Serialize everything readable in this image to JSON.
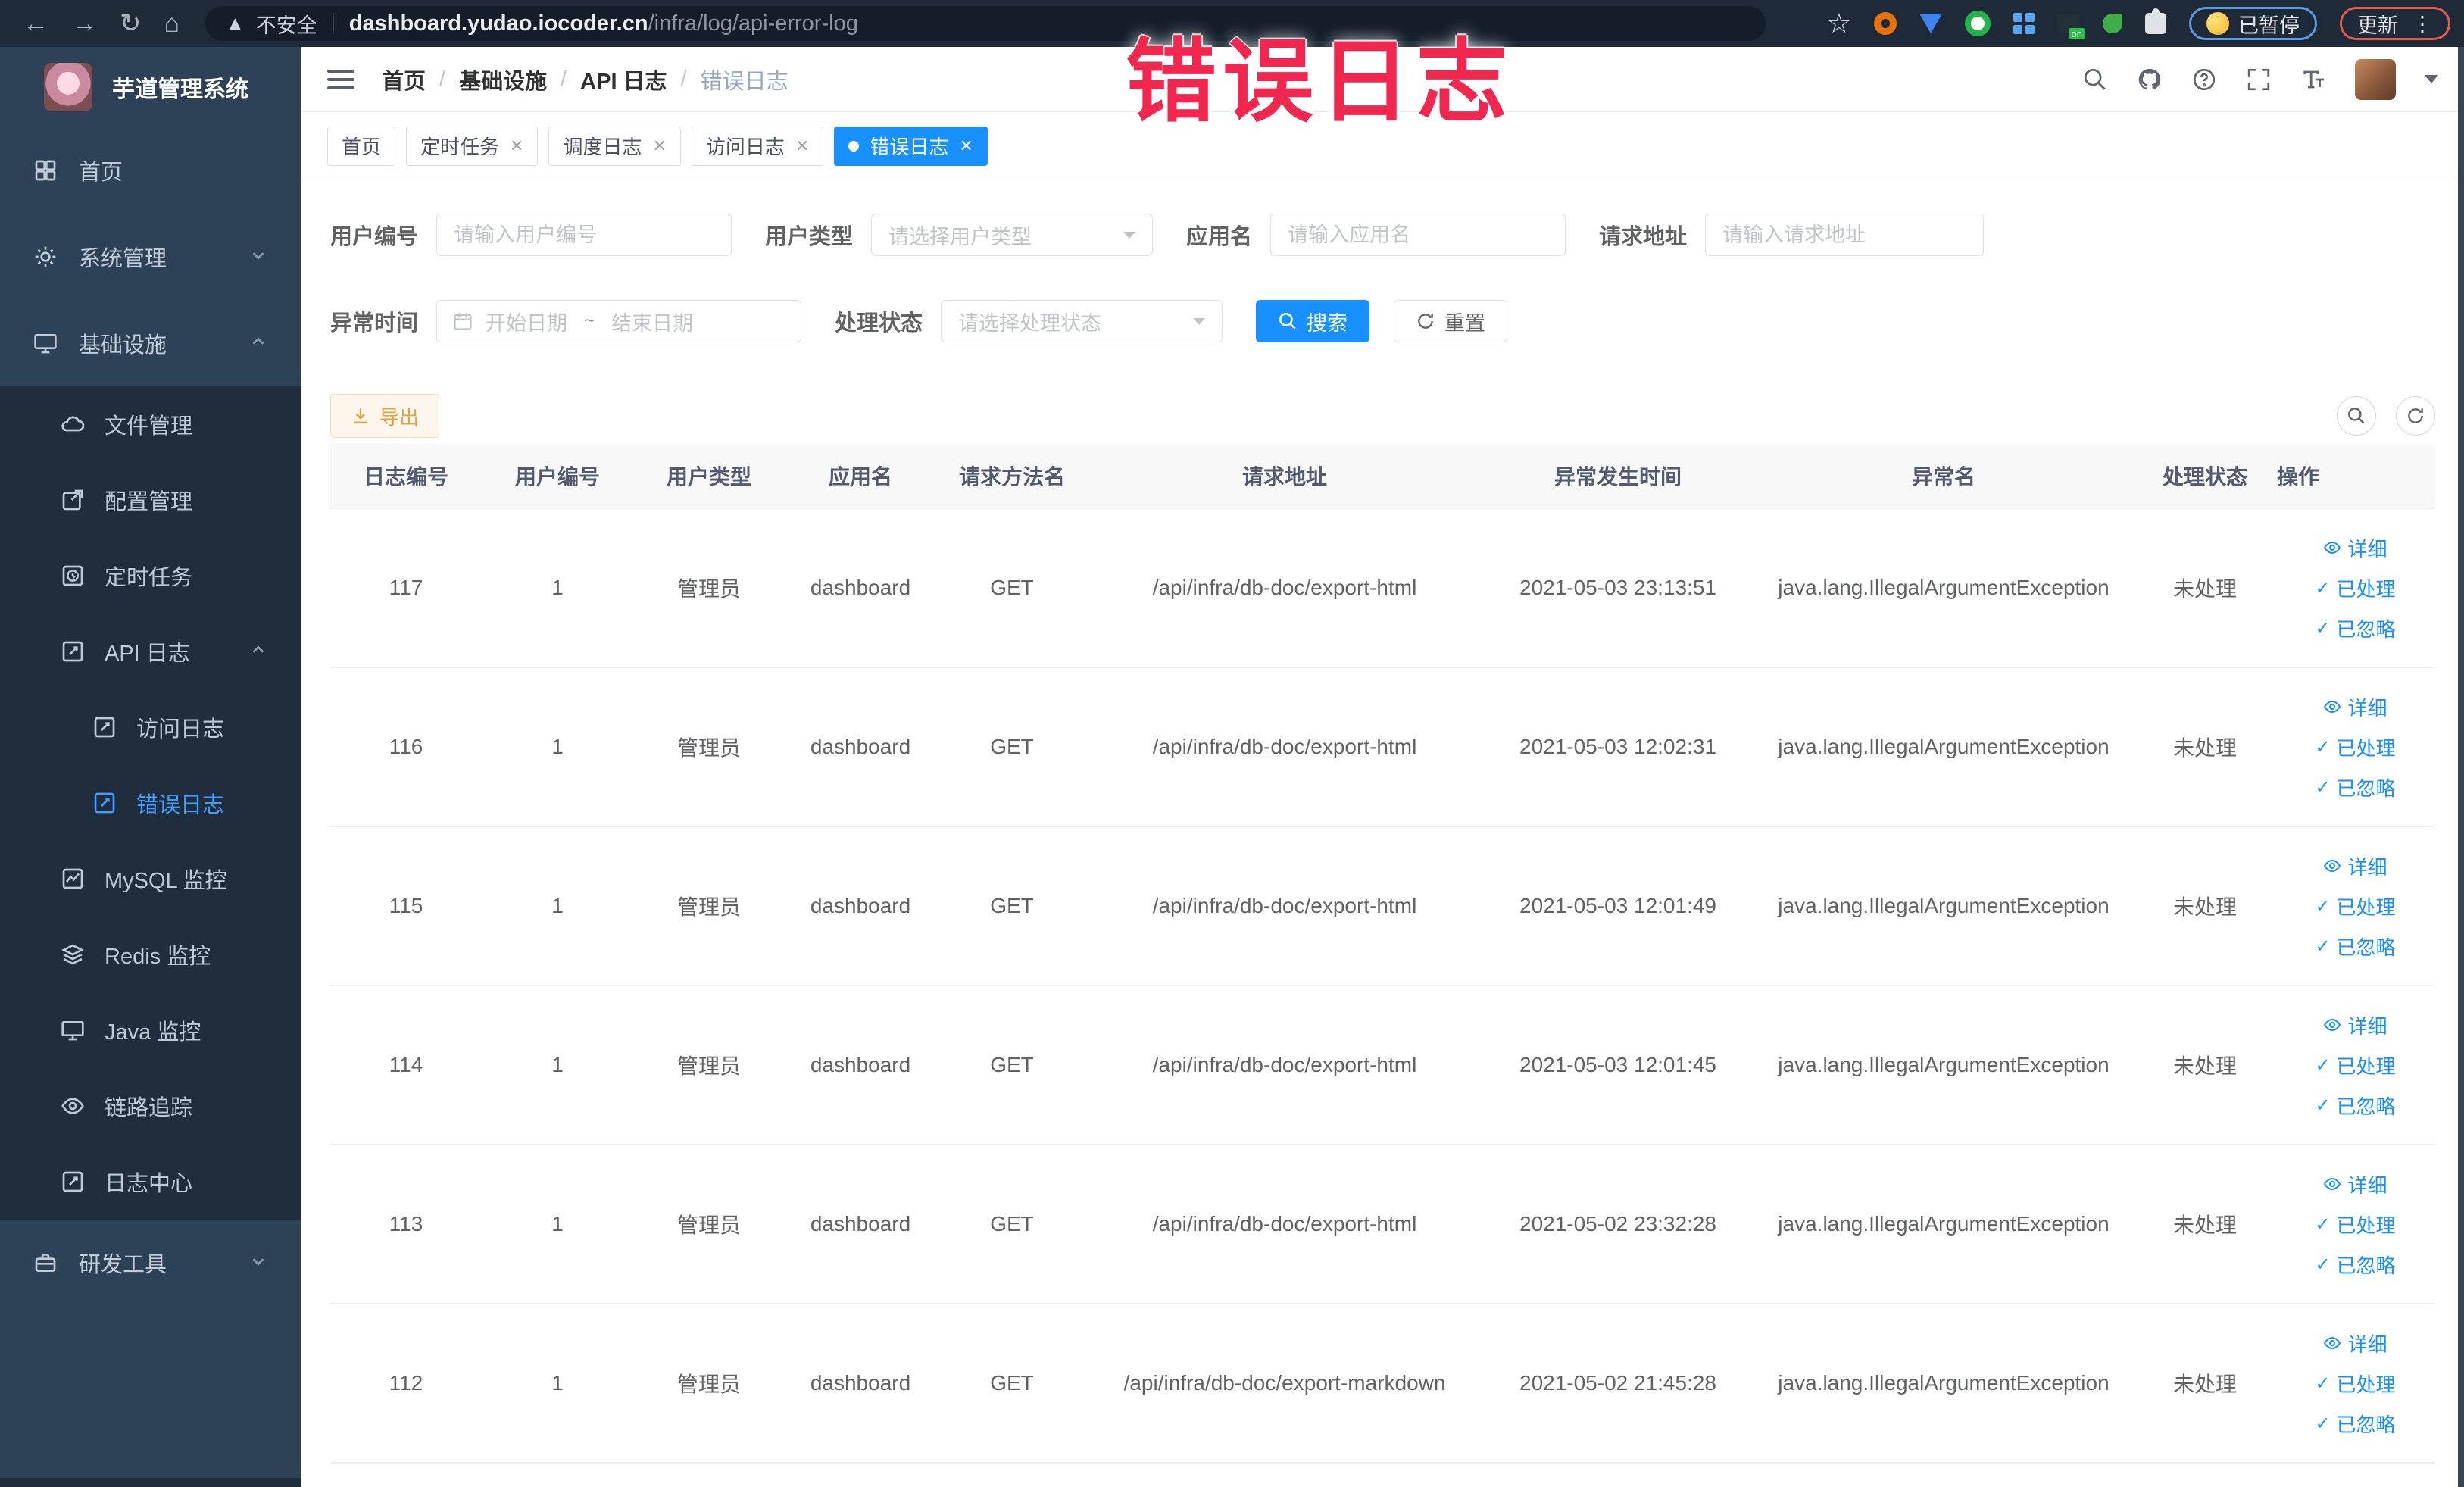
{
  "browser": {
    "security_label": "不安全",
    "url_host": "dashboard.yudao.iocoder.cn",
    "url_path": "/infra/log/api-error-log",
    "paused_label": "已暂停",
    "update_label": "更新"
  },
  "overlay_text": "错误日志",
  "sidebar": {
    "logo_title": "芋道管理系统",
    "items": {
      "home": "首页",
      "system": "系统管理",
      "infra": "基础设施",
      "dev": "研发工具"
    },
    "infra_children": {
      "file": "文件管理",
      "config": "配置管理",
      "job": "定时任务",
      "apilog": "API 日志",
      "access": "访问日志",
      "error": "错误日志",
      "mysql": "MySQL 监控",
      "redis": "Redis 监控",
      "java": "Java 监控",
      "trace": "链路追踪",
      "logcenter": "日志中心"
    }
  },
  "header": {
    "breadcrumb": [
      "首页",
      "基础设施",
      "API 日志",
      "错误日志"
    ]
  },
  "tabs": {
    "items": [
      "首页",
      "定时任务",
      "调度日志",
      "访问日志",
      "错误日志"
    ]
  },
  "filters": {
    "user_id": {
      "label": "用户编号",
      "placeholder": "请输入用户编号"
    },
    "user_type": {
      "label": "用户类型",
      "placeholder": "请选择用户类型"
    },
    "app_name": {
      "label": "应用名",
      "placeholder": "请输入应用名"
    },
    "request_url": {
      "label": "请求地址",
      "placeholder": "请输入请求地址"
    },
    "exception_time": {
      "label": "异常时间",
      "start_placeholder": "开始日期",
      "separator": "~",
      "end_placeholder": "结束日期"
    },
    "process_status": {
      "label": "处理状态",
      "placeholder": "请选择处理状态"
    },
    "search_label": "搜索",
    "reset_label": "重置"
  },
  "toolbar": {
    "export_label": "导出"
  },
  "table": {
    "columns": [
      "日志编号",
      "用户编号",
      "用户类型",
      "应用名",
      "请求方法名",
      "请求地址",
      "异常发生时间",
      "异常名",
      "处理状态",
      "操作"
    ],
    "actions": {
      "detail": "详细",
      "processed": "已处理",
      "ignored": "已忽略"
    },
    "rows": [
      {
        "id": "117",
        "user_id": "1",
        "user_type": "管理员",
        "app": "dashboard",
        "method": "GET",
        "url": "/api/infra/db-doc/export-html",
        "time": "2021-05-03 23:13:51",
        "exception": "java.lang.IllegalArgumentException",
        "status": "未处理"
      },
      {
        "id": "116",
        "user_id": "1",
        "user_type": "管理员",
        "app": "dashboard",
        "method": "GET",
        "url": "/api/infra/db-doc/export-html",
        "time": "2021-05-03 12:02:31",
        "exception": "java.lang.IllegalArgumentException",
        "status": "未处理"
      },
      {
        "id": "115",
        "user_id": "1",
        "user_type": "管理员",
        "app": "dashboard",
        "method": "GET",
        "url": "/api/infra/db-doc/export-html",
        "time": "2021-05-03 12:01:49",
        "exception": "java.lang.IllegalArgumentException",
        "status": "未处理"
      },
      {
        "id": "114",
        "user_id": "1",
        "user_type": "管理员",
        "app": "dashboard",
        "method": "GET",
        "url": "/api/infra/db-doc/export-html",
        "time": "2021-05-03 12:01:45",
        "exception": "java.lang.IllegalArgumentException",
        "status": "未处理"
      },
      {
        "id": "113",
        "user_id": "1",
        "user_type": "管理员",
        "app": "dashboard",
        "method": "GET",
        "url": "/api/infra/db-doc/export-html",
        "time": "2021-05-02 23:32:28",
        "exception": "java.lang.IllegalArgumentException",
        "status": "未处理"
      },
      {
        "id": "112",
        "user_id": "1",
        "user_type": "管理员",
        "app": "dashboard",
        "method": "GET",
        "url": "/api/infra/db-doc/export-markdown",
        "time": "2021-05-02 21:45:28",
        "exception": "java.lang.IllegalArgumentException",
        "status": "未处理"
      }
    ]
  }
}
